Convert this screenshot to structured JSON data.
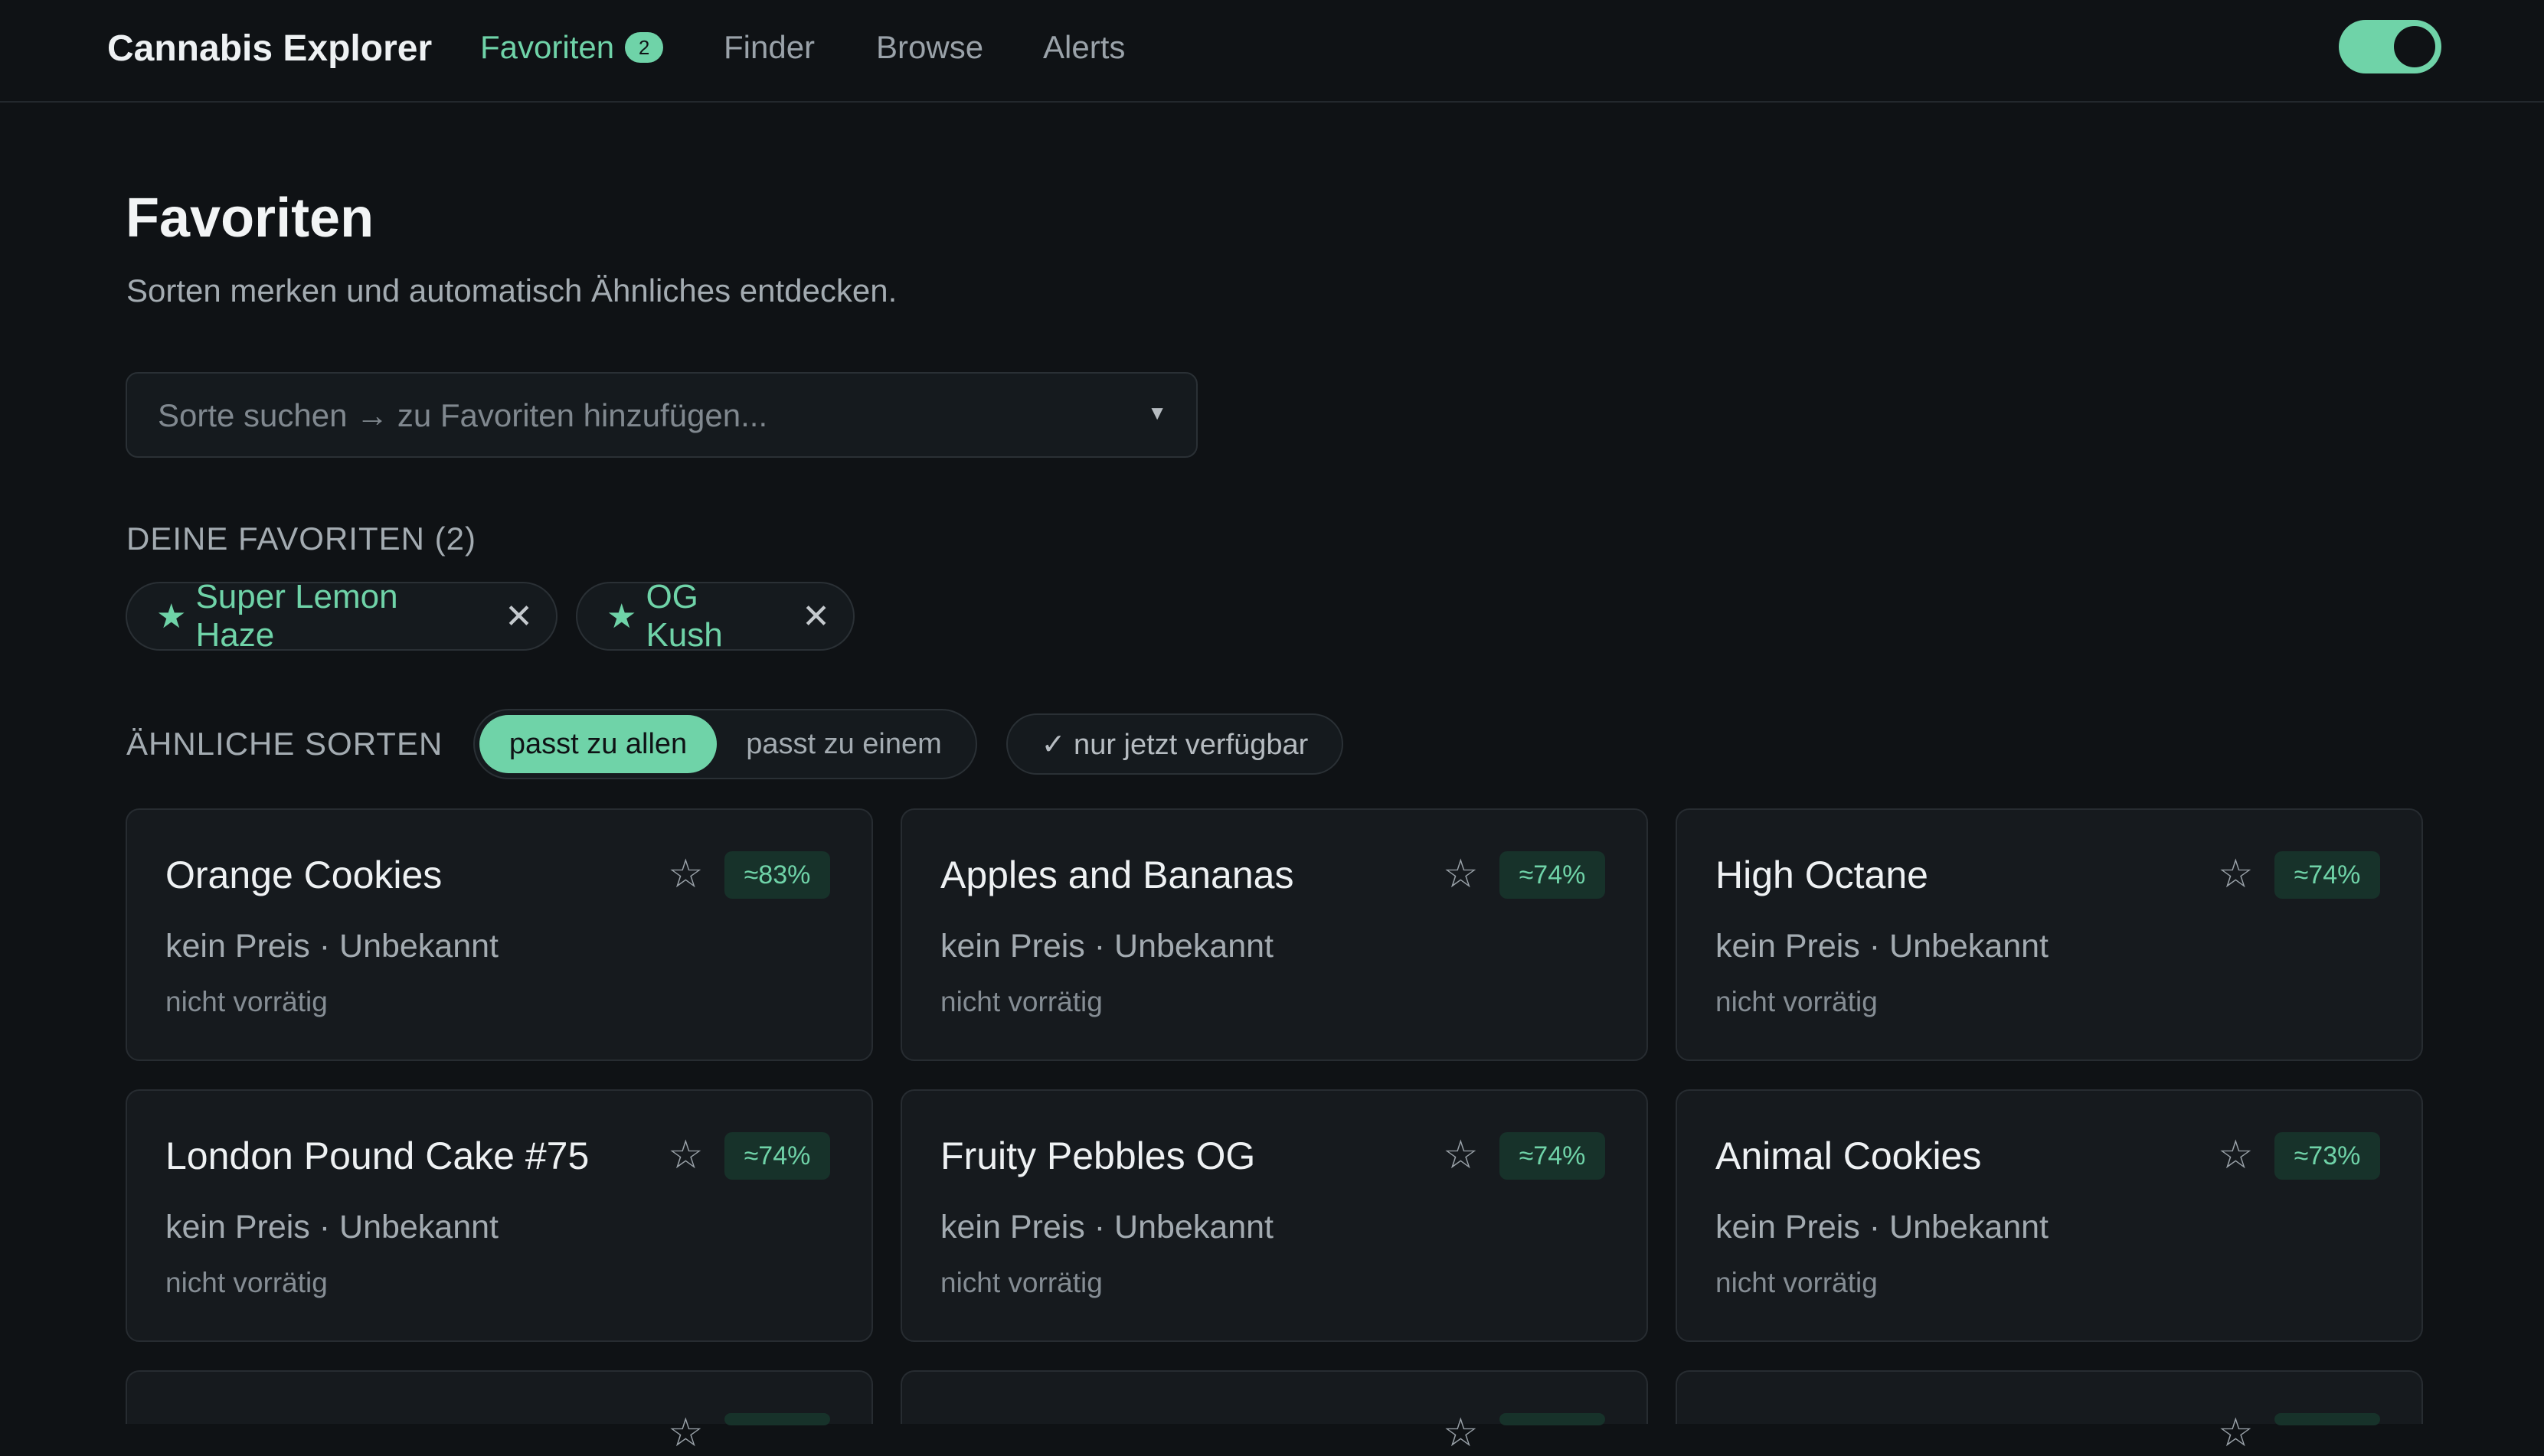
{
  "nav": {
    "brand": "Cannabis Explorer",
    "links": [
      {
        "label": "Favoriten",
        "badge": "2",
        "active": true
      },
      {
        "label": "Finder"
      },
      {
        "label": "Browse"
      },
      {
        "label": "Alerts"
      }
    ],
    "toggle_on": true
  },
  "header": {
    "title": "Favoriten",
    "subtitle": "Sorten merken und automatisch Ähnliches entdecken."
  },
  "search": {
    "placeholder": "Sorte suchen → zu Favoriten hinzufügen..."
  },
  "favorites": {
    "label": "DEINE FAVORITEN (2)",
    "chips": [
      "Super Lemon Haze",
      "OG Kush"
    ]
  },
  "similar": {
    "label": "ÄHNLICHE SORTEN",
    "segment": {
      "all": "passt zu allen",
      "one": "passt zu einem",
      "selected": "all"
    },
    "filter_label": "✓ nur jetzt verfügbar",
    "cards": [
      {
        "name": "Orange Cookies",
        "match": "≈83%",
        "meta": "kein Preis · Unbekannt",
        "stock": "nicht vorrätig"
      },
      {
        "name": "Apples and Bananas",
        "match": "≈74%",
        "meta": "kein Preis · Unbekannt",
        "stock": "nicht vorrätig"
      },
      {
        "name": "High Octane",
        "match": "≈74%",
        "meta": "kein Preis · Unbekannt",
        "stock": "nicht vorrätig"
      },
      {
        "name": "London Pound Cake #75",
        "match": "≈74%",
        "meta": "kein Preis · Unbekannt",
        "stock": "nicht vorrätig"
      },
      {
        "name": "Fruity Pebbles OG",
        "match": "≈74%",
        "meta": "kein Preis · Unbekannt",
        "stock": "nicht vorrätig"
      },
      {
        "name": "Animal Cookies",
        "match": "≈73%",
        "meta": "kein Preis · Unbekannt",
        "stock": "nicht vorrätig"
      }
    ]
  },
  "colors": {
    "accent": "#6fd3a8",
    "background": "#0f1215",
    "card": "#161a1e"
  }
}
